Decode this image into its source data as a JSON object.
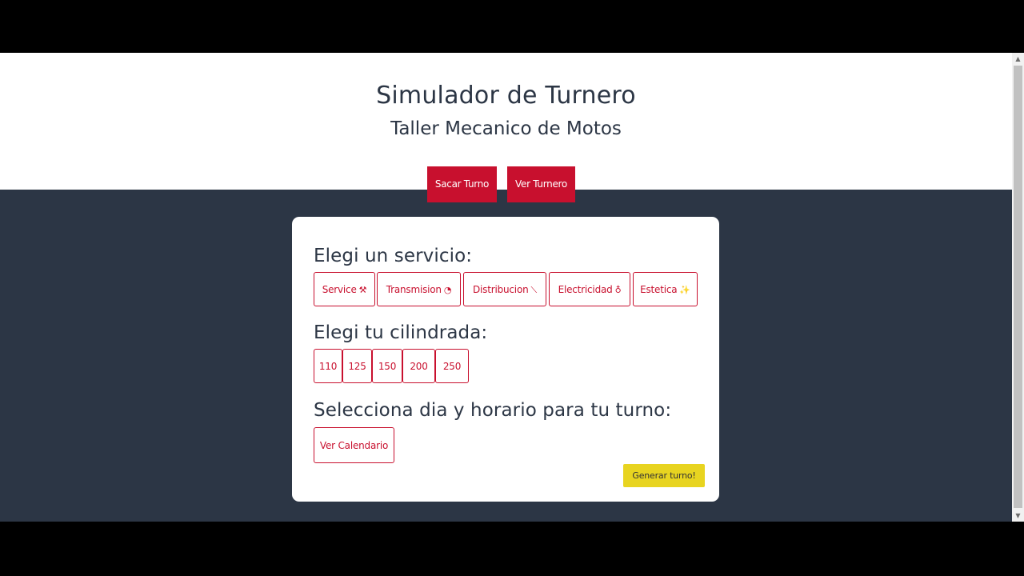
{
  "header": {
    "title": "Simulador de Turnero",
    "subtitle": "Taller Mecanico de Motos"
  },
  "nav": {
    "sacar_turno": "Sacar Turno",
    "ver_turnero": "Ver Turnero"
  },
  "servicio": {
    "heading": "Elegi un servicio:",
    "options": [
      {
        "label": "Service",
        "icon": "tools-icon",
        "glyph": "⚒"
      },
      {
        "label": "Transmision",
        "icon": "speedometer-icon",
        "glyph": "◔"
      },
      {
        "label": "Distribucion",
        "icon": "screwdriver-icon",
        "glyph": "⟍"
      },
      {
        "label": "Electricidad",
        "icon": "lightbulb-icon",
        "glyph": "♁"
      },
      {
        "label": "Estetica",
        "icon": "sparkle-icon",
        "glyph": "✨"
      }
    ]
  },
  "cilindrada": {
    "heading": "Elegi tu cilindrada:",
    "options": [
      "110",
      "125",
      "150",
      "200",
      "250"
    ]
  },
  "turno": {
    "heading": "Selecciona dia y horario para tu turno:",
    "calendar_label": "Ver Calendario"
  },
  "generar": {
    "label": "Generar turno!"
  },
  "colors": {
    "accent": "#c8102e",
    "background": "#2c3645",
    "generate": "#e8d420"
  }
}
